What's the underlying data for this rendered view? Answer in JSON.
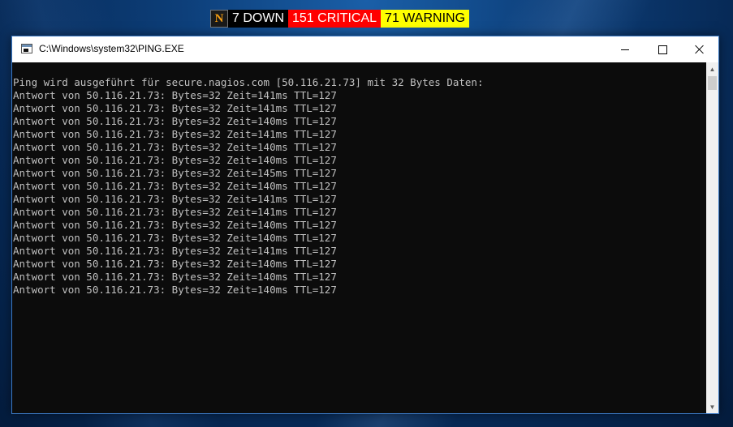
{
  "nagios": {
    "logo": "N",
    "down": "7 DOWN",
    "critical": "151 CRITICAL",
    "warning": "71 WARNING",
    "colors": {
      "down_bg": "#000000",
      "critical_bg": "#ff0000",
      "warning_bg": "#ffff00"
    }
  },
  "window": {
    "title": "C:\\Windows\\system32\\PING.EXE",
    "icon": "console-icon"
  },
  "console": {
    "lines": [
      "Ping wird ausgeführt für secure.nagios.com [50.116.21.73] mit 32 Bytes Daten:",
      "Antwort von 50.116.21.73: Bytes=32 Zeit=141ms TTL=127",
      "Antwort von 50.116.21.73: Bytes=32 Zeit=141ms TTL=127",
      "Antwort von 50.116.21.73: Bytes=32 Zeit=140ms TTL=127",
      "Antwort von 50.116.21.73: Bytes=32 Zeit=141ms TTL=127",
      "Antwort von 50.116.21.73: Bytes=32 Zeit=140ms TTL=127",
      "Antwort von 50.116.21.73: Bytes=32 Zeit=140ms TTL=127",
      "Antwort von 50.116.21.73: Bytes=32 Zeit=145ms TTL=127",
      "Antwort von 50.116.21.73: Bytes=32 Zeit=140ms TTL=127",
      "Antwort von 50.116.21.73: Bytes=32 Zeit=141ms TTL=127",
      "Antwort von 50.116.21.73: Bytes=32 Zeit=141ms TTL=127",
      "Antwort von 50.116.21.73: Bytes=32 Zeit=140ms TTL=127",
      "Antwort von 50.116.21.73: Bytes=32 Zeit=140ms TTL=127",
      "Antwort von 50.116.21.73: Bytes=32 Zeit=141ms TTL=127",
      "Antwort von 50.116.21.73: Bytes=32 Zeit=140ms TTL=127",
      "Antwort von 50.116.21.73: Bytes=32 Zeit=140ms TTL=127",
      "Antwort von 50.116.21.73: Bytes=32 Zeit=140ms TTL=127"
    ],
    "text_color": "#c0c0c0",
    "background": "#0c0c0c"
  },
  "scrollbar": {
    "up_icon": "▲",
    "down_icon": "▼"
  }
}
